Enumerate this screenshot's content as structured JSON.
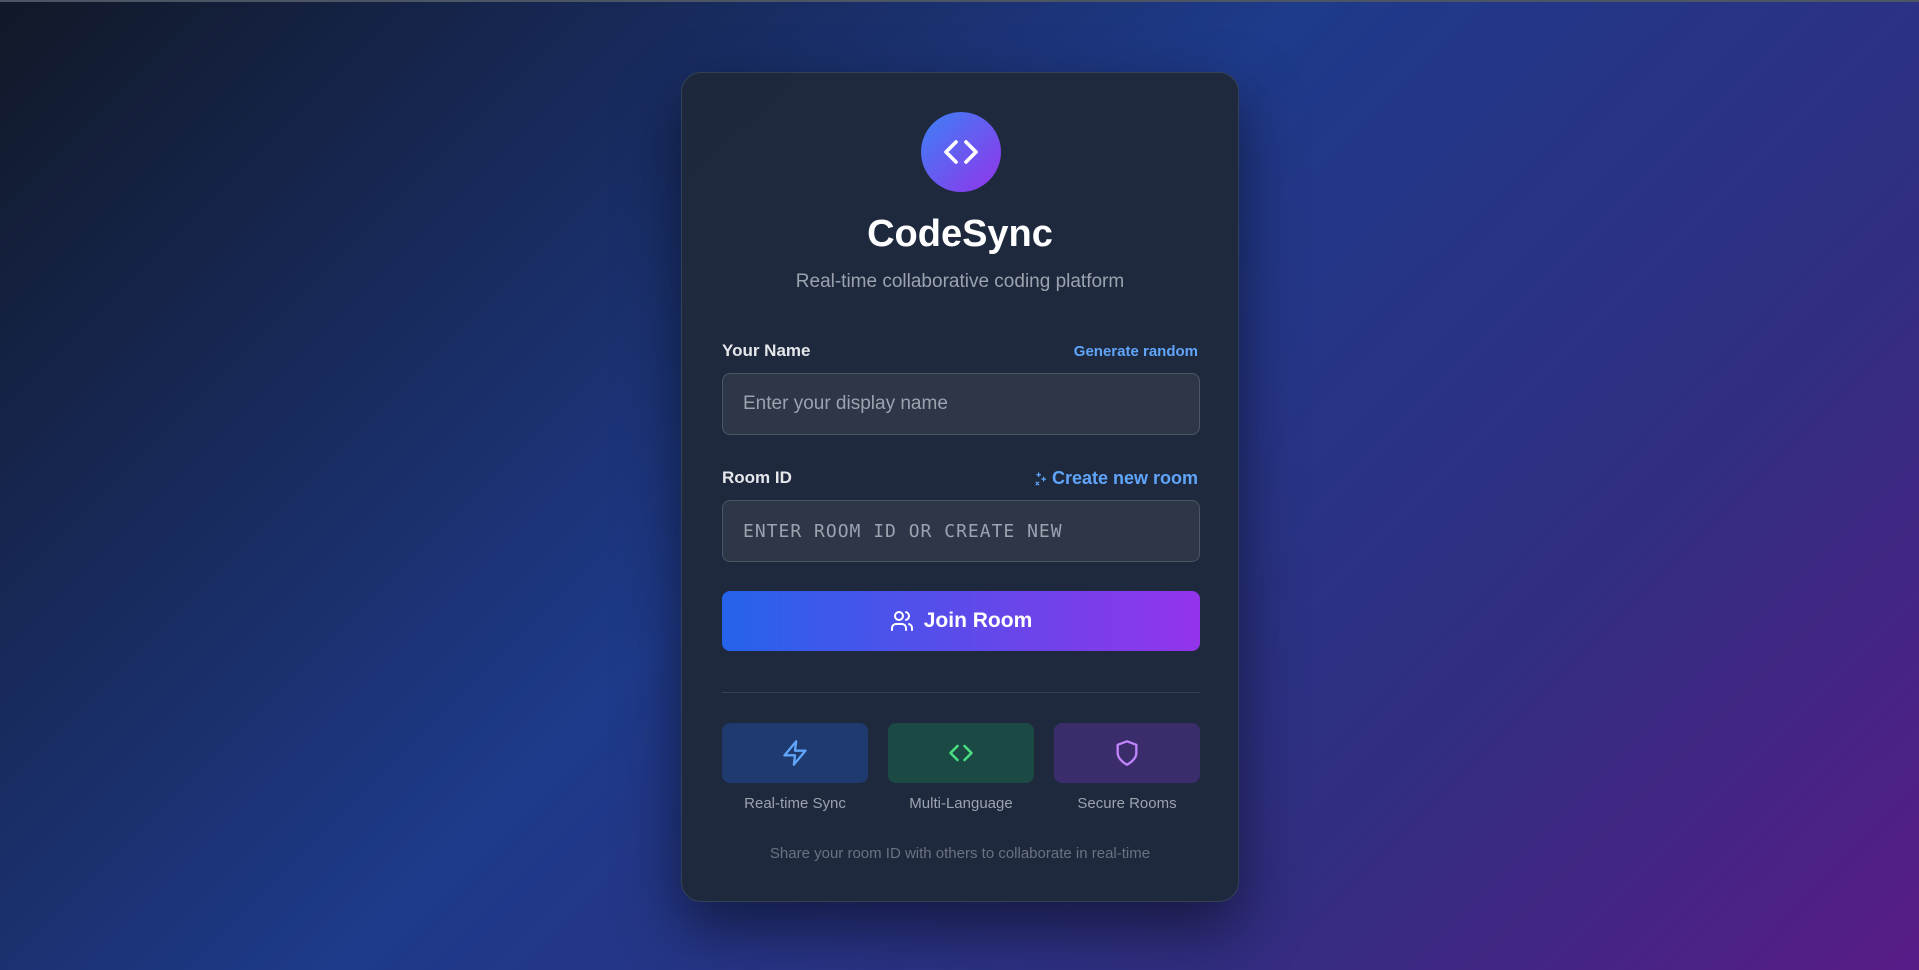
{
  "app": {
    "title": "CodeSync",
    "subtitle": "Real-time collaborative coding platform"
  },
  "form": {
    "name_label": "Your Name",
    "name_link": "Generate random",
    "name_placeholder": "Enter your display name",
    "name_value": "",
    "room_label": "Room ID",
    "room_link": "Create new room",
    "room_placeholder": "ENTER ROOM ID OR CREATE NEW",
    "room_value": "",
    "join_label": "Join Room"
  },
  "features": [
    {
      "label": "Real-time Sync",
      "icon": "lightning-icon",
      "color": "#60a5fa",
      "bg": "#1e3a6e"
    },
    {
      "label": "Multi-Language",
      "icon": "code-icon",
      "color": "#4ade80",
      "bg": "#1b4a45"
    },
    {
      "label": "Secure Rooms",
      "icon": "shield-icon",
      "color": "#c084fc",
      "bg": "#3b2d6b"
    }
  ],
  "footer": "Share your room ID with others to collaborate in real-time",
  "colors": {
    "accent_blue": "#2563eb",
    "accent_purple": "#9333ea",
    "link": "#60a5fa"
  }
}
